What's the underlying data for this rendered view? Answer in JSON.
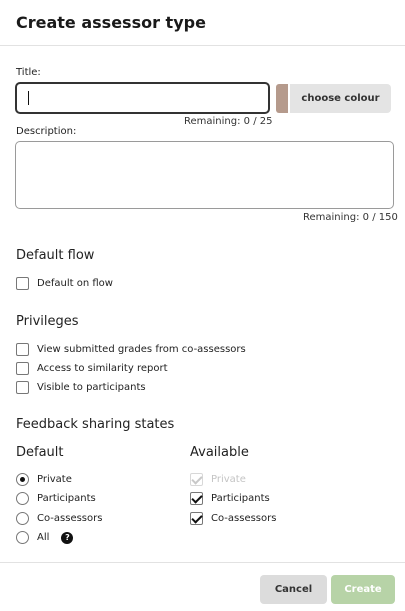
{
  "dialog": {
    "title": "Create assessor type"
  },
  "form": {
    "title_label": "Title:",
    "title_value": "",
    "choose_colour_label": "choose colour",
    "colour": "#b59a8c",
    "title_remaining": "Remaining: 0 / 25",
    "description_label": "Description:",
    "description_value": "",
    "description_remaining": "Remaining: 0 / 150"
  },
  "default_flow": {
    "heading": "Default flow",
    "option": {
      "label": "Default on flow",
      "checked": false
    }
  },
  "privileges": {
    "heading": "Privileges",
    "options": [
      {
        "label": "View submitted grades from co-assessors",
        "checked": false
      },
      {
        "label": "Access to similarity report",
        "checked": false
      },
      {
        "label": "Visible to participants",
        "checked": false
      }
    ]
  },
  "feedback_sharing": {
    "heading": "Feedback sharing states",
    "default_heading": "Default",
    "available_heading": "Available",
    "default_options": [
      {
        "label": "Private",
        "selected": true
      },
      {
        "label": "Participants",
        "selected": false
      },
      {
        "label": "Co-assessors",
        "selected": false
      },
      {
        "label": "All",
        "selected": false
      }
    ],
    "available_options": [
      {
        "label": "Private",
        "checked": true,
        "disabled": true
      },
      {
        "label": "Participants",
        "checked": true,
        "disabled": false
      },
      {
        "label": "Co-assessors",
        "checked": true,
        "disabled": false
      }
    ],
    "help_icon": "question-circle-icon"
  },
  "footer": {
    "cancel_label": "Cancel",
    "create_label": "Create",
    "create_color": "#b7d3a7"
  }
}
